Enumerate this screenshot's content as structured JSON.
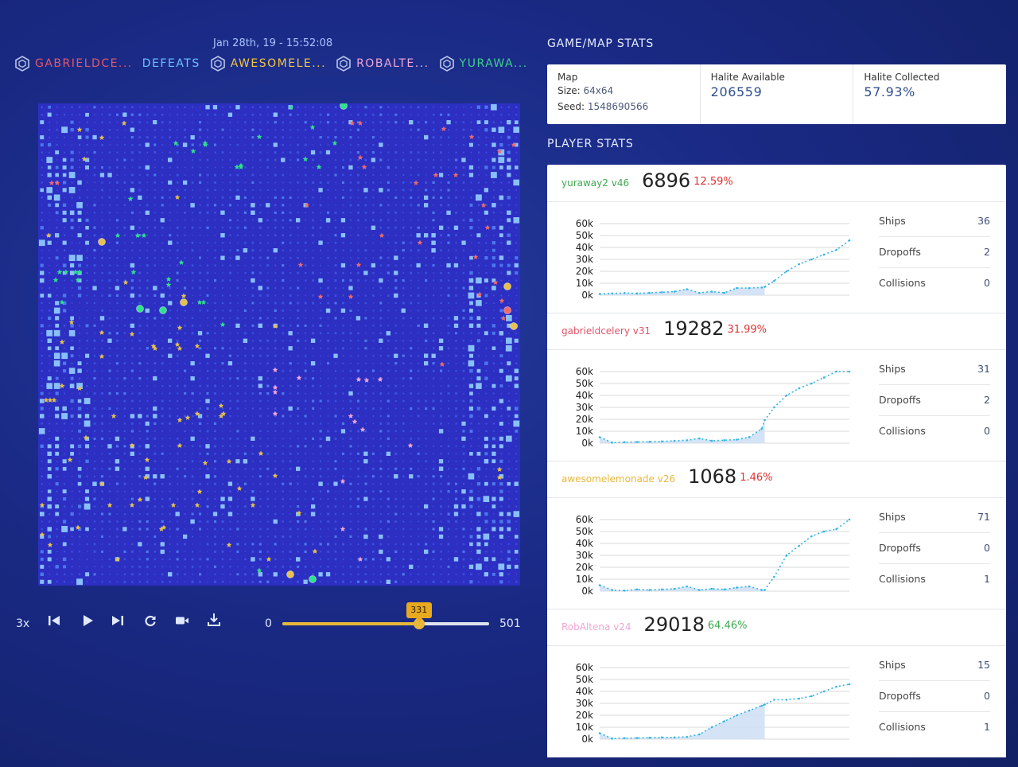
{
  "header": {
    "date": "Jan 28th, 19 - 15:52:08",
    "players": [
      {
        "label": "GABRIELDCE...",
        "color": "#e5566b",
        "icon": "hexagon-icon"
      },
      {
        "label": "DEFEATS",
        "color": "#6cc1ff",
        "icon": null
      },
      {
        "label": "AWESOMELE...",
        "color": "#f2c640",
        "icon": "hexagon-icon"
      },
      {
        "label": "ROBALTE...",
        "color": "#f0a6d8",
        "icon": "hexagon-icon"
      },
      {
        "label": "YURAWA...",
        "color": "#3fd08e",
        "icon": "hexagon-icon"
      }
    ]
  },
  "controls": {
    "speed": "3x",
    "icons": [
      "skip-back-icon",
      "play-icon",
      "skip-forward-icon",
      "refresh-icon",
      "camera-icon",
      "download-icon"
    ],
    "slider_min": "0",
    "slider_max": "501",
    "slider_value": "331",
    "slider_fraction": 0.6607
  },
  "game_stats": {
    "title": "GAME/MAP STATS",
    "map_label": "Map",
    "size_label": "Size:",
    "size_value": "64x64",
    "seed_label": "Seed:",
    "seed_value": "1548690566",
    "halite_available_label": "Halite Available",
    "halite_available": "206559",
    "halite_collected_label": "Halite Collected",
    "halite_collected": "57.93%"
  },
  "player_stats": {
    "title": "PLAYER STATS",
    "stat_labels": {
      "ships": "Ships",
      "dropoffs": "Dropoffs",
      "collisions": "Collisions"
    },
    "players": [
      {
        "name": "yuraway2 v46",
        "color": "#3ea84f",
        "score": "6896",
        "pct": "12.59%",
        "pct_color": "#e03131",
        "ships": "36",
        "dropoffs": "2",
        "collisions": "0"
      },
      {
        "name": "gabrieldcelery v31",
        "color": "#e0556a",
        "score": "19282",
        "pct": "31.99%",
        "pct_color": "#e03131",
        "ships": "31",
        "dropoffs": "2",
        "collisions": "0"
      },
      {
        "name": "awesomelemonade v26",
        "color": "#e9b73a",
        "score": "1068",
        "pct": "1.46%",
        "pct_color": "#e03131",
        "ships": "71",
        "dropoffs": "0",
        "collisions": "1"
      },
      {
        "name": "RobAltena v24",
        "color": "#f1a5d4",
        "score": "29018",
        "pct": "64.46%",
        "pct_color": "#3ea84f",
        "ships": "15",
        "dropoffs": "0",
        "collisions": "1"
      }
    ]
  },
  "chart_data": [
    {
      "type": "line",
      "series": [
        {
          "name": "yuraway2 v46",
          "x": [
            0,
            25,
            50,
            75,
            100,
            125,
            150,
            175,
            200,
            225,
            250,
            275,
            300,
            325,
            331,
            350,
            375,
            400,
            425,
            450,
            475,
            501
          ],
          "values": [
            1000,
            1500,
            1800,
            1500,
            2000,
            2500,
            3000,
            5000,
            2000,
            3000,
            2000,
            6000,
            6000,
            6500,
            7000,
            12000,
            20000,
            26000,
            30000,
            34000,
            38000,
            46000
          ]
        }
      ],
      "y_ticks": [
        "60k",
        "50k",
        "40k",
        "30k",
        "20k",
        "10k",
        "0k"
      ],
      "ylim": [
        0,
        60000
      ]
    },
    {
      "type": "line",
      "series": [
        {
          "name": "gabrieldcelery v31",
          "x": [
            0,
            25,
            50,
            75,
            100,
            125,
            150,
            175,
            200,
            225,
            250,
            275,
            300,
            325,
            331,
            350,
            375,
            400,
            425,
            450,
            475,
            501
          ],
          "values": [
            5000,
            500,
            800,
            1000,
            1200,
            1500,
            2000,
            2500,
            4000,
            2000,
            2500,
            3000,
            5000,
            12000,
            19282,
            30000,
            40000,
            46000,
            50000,
            55000,
            60000,
            64000
          ]
        }
      ],
      "y_ticks": [
        "60k",
        "50k",
        "40k",
        "30k",
        "20k",
        "10k",
        "0k"
      ],
      "ylim": [
        0,
        60000
      ]
    },
    {
      "type": "line",
      "series": [
        {
          "name": "awesomelemonade v26",
          "x": [
            0,
            25,
            50,
            75,
            100,
            125,
            150,
            175,
            200,
            225,
            250,
            275,
            300,
            325,
            331,
            350,
            375,
            400,
            425,
            450,
            475,
            501
          ],
          "values": [
            5000,
            1000,
            500,
            1500,
            1000,
            1500,
            2000,
            4000,
            1000,
            2000,
            1500,
            3000,
            4000,
            1000,
            1068,
            12000,
            30000,
            38000,
            46000,
            50000,
            52000,
            60000
          ]
        }
      ],
      "y_ticks": [
        "60k",
        "50k",
        "40k",
        "30k",
        "20k",
        "10k",
        "0k"
      ],
      "ylim": [
        0,
        60000
      ]
    },
    {
      "type": "line",
      "series": [
        {
          "name": "RobAltena v24",
          "x": [
            0,
            25,
            50,
            75,
            100,
            125,
            150,
            175,
            200,
            225,
            250,
            275,
            300,
            325,
            331,
            350,
            375,
            400,
            425,
            450,
            475,
            501
          ],
          "values": [
            5000,
            500,
            800,
            1000,
            1200,
            1500,
            1500,
            2000,
            4000,
            10000,
            15000,
            20000,
            24000,
            28000,
            29018,
            33000,
            33000,
            34000,
            36000,
            40000,
            44000,
            46000
          ]
        }
      ],
      "y_ticks": [
        "60k",
        "50k",
        "40k",
        "30k",
        "20k",
        "10k",
        "0k"
      ],
      "ylim": [
        0,
        60000
      ]
    }
  ]
}
